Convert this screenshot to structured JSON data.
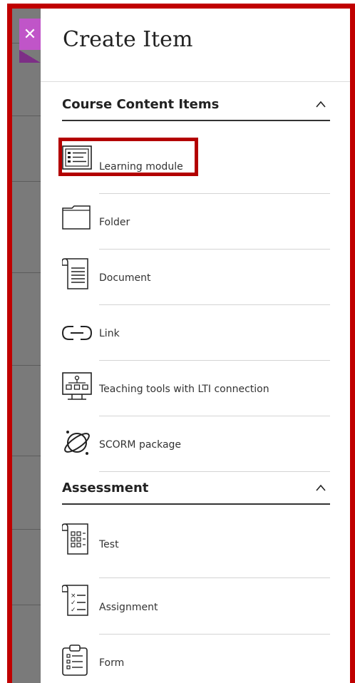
{
  "panel": {
    "title": "Create Item",
    "close_icon": "close-icon",
    "accent_color": "#c055c8",
    "highlight_color": "#b30000"
  },
  "sections": [
    {
      "title": "Course Content Items",
      "collapse_icon": "chevron-up-icon",
      "items": [
        {
          "label": "Learning module",
          "icon": "learning-module-icon"
        },
        {
          "label": "Folder",
          "icon": "folder-icon"
        },
        {
          "label": "Document",
          "icon": "document-icon"
        },
        {
          "label": "Link",
          "icon": "link-icon"
        },
        {
          "label": "Teaching tools with LTI connection",
          "icon": "lti-tools-icon"
        },
        {
          "label": "SCORM package",
          "icon": "scorm-package-icon"
        }
      ]
    },
    {
      "title": "Assessment",
      "collapse_icon": "chevron-up-icon",
      "items": [
        {
          "label": "Test",
          "icon": "test-icon"
        },
        {
          "label": "Assignment",
          "icon": "assignment-icon"
        },
        {
          "label": "Form",
          "icon": "form-icon"
        }
      ]
    }
  ]
}
